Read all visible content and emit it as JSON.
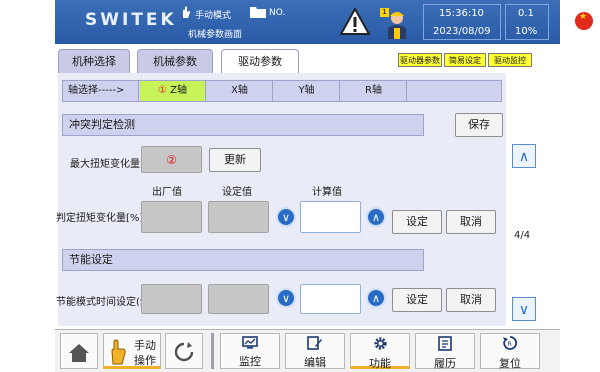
{
  "header": {
    "logo": "SWITEK",
    "mode_label": "手动模式",
    "file_label": "NO.",
    "screen_name": "机械参数画面",
    "badge": "1",
    "time": "15:36:10",
    "date": "2023/08/09",
    "speed": "0.1",
    "percent": "10%",
    "icons": [
      "hand-icon",
      "folder-icon",
      "warning-icon",
      "worker-icon",
      "china-flag-icon"
    ]
  },
  "tabs": [
    {
      "label": "机种选择",
      "active": false
    },
    {
      "label": "机械参数",
      "active": false
    },
    {
      "label": "驱动参数",
      "active": true
    }
  ],
  "mini_buttons": [
    {
      "label": "驱动器参数",
      "color": "#ffff33"
    },
    {
      "label": "简易设定",
      "color": "#ffff33"
    },
    {
      "label": "驱动监控",
      "color": "#ffff33"
    }
  ],
  "axis": {
    "label": "轴选择----->",
    "items": [
      "Z轴",
      "X轴",
      "Y轴",
      "R轴"
    ],
    "selected_marker": "①",
    "selected_color": "#c8f25a"
  },
  "collision": {
    "title": "冲突判定检测",
    "save": "保存",
    "max_torque_label": "最大扭矩变化量",
    "marker": "②",
    "update": "更新",
    "col_factory": "出厂值",
    "col_setting": "设定值",
    "col_calc": "计算值",
    "torque_label": "判定扭矩变化量[%]",
    "set": "设定",
    "cancel": "取消"
  },
  "energy": {
    "title": "节能设定",
    "time_label": "节能模式时间设定(S)",
    "set": "设定",
    "cancel": "取消"
  },
  "page_indicator": "4/4",
  "bottom_nav": [
    {
      "label": "",
      "icon": "home-icon"
    },
    {
      "label": "手动\n操作",
      "icon": "hand-icon"
    },
    {
      "label": "",
      "icon": "refresh-icon"
    },
    {
      "label": "监控",
      "icon": "monitor-icon"
    },
    {
      "label": "编辑",
      "icon": "edit-icon"
    },
    {
      "label": "功能",
      "icon": "gear-icon"
    },
    {
      "label": "履历",
      "icon": "history-icon"
    },
    {
      "label": "复位",
      "icon": "reset-icon"
    }
  ],
  "active_nav_color": "#f2b12b"
}
